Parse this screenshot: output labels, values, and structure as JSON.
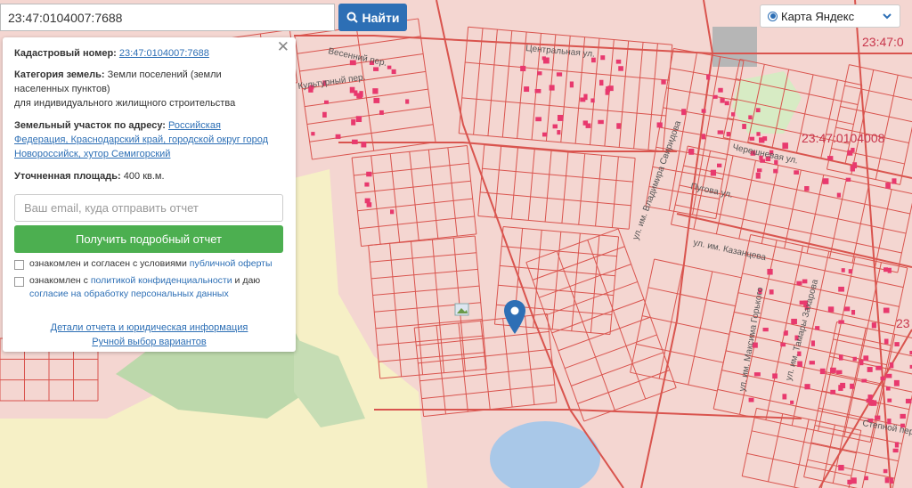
{
  "search": {
    "value": "23:47:0104007:7688",
    "button_label": "Найти"
  },
  "map_type": {
    "selected": "Карта Яндекс"
  },
  "panel": {
    "cadastral_label": "Кадастровый номер:",
    "cadastral_value": "23:47:0104007:7688",
    "category_label": "Категория земель:",
    "category_value_1": "Земли поселений (земли",
    "category_value_2": "населенных пунктов)",
    "category_value_3": "для индивидуального жилищного строительства",
    "address_label": "Земельный участок по адресу:",
    "address_value_1": "Российская",
    "address_value_2": "Федерация, Краснодарский край, городской округ город",
    "address_value_3": "Новороссийск, хутор Семигорский",
    "area_label": "Уточненная площадь:",
    "area_value": "400 кв.м.",
    "email_placeholder": "Ваш email, куда отправить отчет",
    "report_button": "Получить подробный отчет",
    "consent1_text": "ознакомлен и согласен с условиями",
    "consent1_link": "публичной оферты",
    "consent2_text": "ознакомлен с",
    "consent2_link1": "политикой конфиденциальности",
    "consent2_mid": "и даю",
    "consent2_link2": "согласие на обработку персональных данных",
    "details_link": "Детали отчета и юридическая информация",
    "manual_link": "Ручной выбор вариантов"
  },
  "map_labels": {
    "street_central": "Центральная ул.",
    "street_vesenny": "Весенний пер.",
    "street_kultur": "Культурный пер.",
    "street_pugova": "Пугова ул.",
    "street_chereshnevaya": "Черешневая ул.",
    "street_stepnaya": "Степной пер.",
    "street_vladimir": "ул. им. Владимира Свиридова",
    "street_kazanskaya": "ул. им. Казанцева",
    "street_maksim": "ул. им. Максима Горького",
    "street_tamary": "ул. им. Тамары Захарова",
    "cadastral_right": "23:47:0104008",
    "cadastral_top_right": "23:47:0",
    "cadastral_edge": "23"
  },
  "colors": {
    "accent": "#2d6fb5",
    "report_button": "#4caf50",
    "parcel_line": "#d9544e",
    "parcel_fill": "#f4d6d1",
    "water": "#a9c8e8",
    "forest": "#b9d6a8",
    "field": "#f7f1c2",
    "building": "#e8396e"
  }
}
